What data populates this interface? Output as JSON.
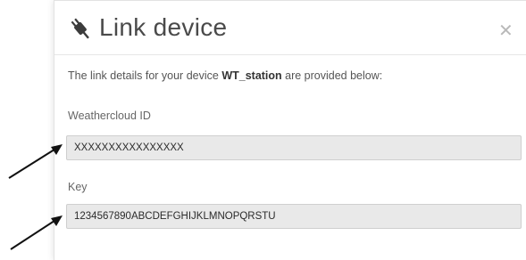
{
  "dialog": {
    "title": "Link device",
    "intro_prefix": "The link details for your device ",
    "device_name": "WT_station",
    "intro_suffix": " are provided below:",
    "close_icon": "close-icon",
    "title_icon": "plug-icon"
  },
  "fields": {
    "weathercloud_id": {
      "label": "Weathercloud ID",
      "value": "XXXXXXXXXXXXXXXX"
    },
    "key": {
      "label": "Key",
      "value": "1234567890ABCDEFGHIJKLMNOPQRSTU"
    }
  },
  "colors": {
    "field_bg": "#e9e9e9",
    "title": "#4a4a4a",
    "arrow": "#111111"
  }
}
